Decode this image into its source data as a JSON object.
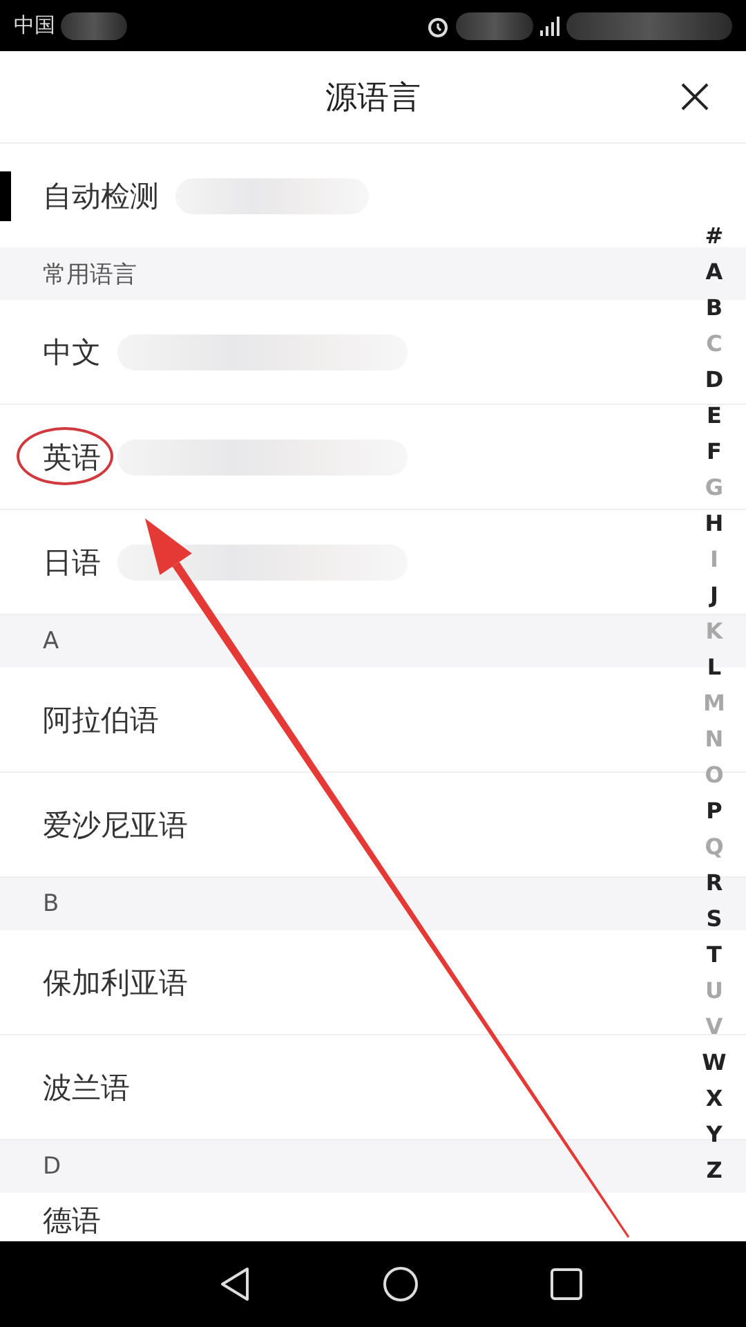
{
  "status_bar": {
    "carrier": "中国"
  },
  "header": {
    "title": "源语言"
  },
  "auto_detect": {
    "label": "自动检测",
    "selected": true,
    "redacted": true
  },
  "sections": [
    {
      "title": "常用语言",
      "items": [
        {
          "label": "中文",
          "redacted": true,
          "circled": false
        },
        {
          "label": "英语",
          "redacted": true,
          "circled": true
        },
        {
          "label": "日语",
          "redacted": true,
          "circled": false
        }
      ]
    },
    {
      "title": "A",
      "items": [
        {
          "label": "阿拉伯语",
          "redacted": false,
          "circled": false
        },
        {
          "label": "爱沙尼亚语",
          "redacted": false,
          "circled": false
        }
      ]
    },
    {
      "title": "B",
      "items": [
        {
          "label": "保加利亚语",
          "redacted": false,
          "circled": false
        },
        {
          "label": "波兰语",
          "redacted": false,
          "circled": false
        }
      ]
    },
    {
      "title": "D",
      "items": [
        {
          "label": "德语",
          "redacted": false,
          "circled": false
        }
      ]
    }
  ],
  "index": [
    {
      "letter": "#",
      "enabled": true
    },
    {
      "letter": "A",
      "enabled": true
    },
    {
      "letter": "B",
      "enabled": true
    },
    {
      "letter": "C",
      "enabled": false
    },
    {
      "letter": "D",
      "enabled": true
    },
    {
      "letter": "E",
      "enabled": true
    },
    {
      "letter": "F",
      "enabled": true
    },
    {
      "letter": "G",
      "enabled": false
    },
    {
      "letter": "H",
      "enabled": true
    },
    {
      "letter": "I",
      "enabled": false
    },
    {
      "letter": "J",
      "enabled": true
    },
    {
      "letter": "K",
      "enabled": false
    },
    {
      "letter": "L",
      "enabled": true
    },
    {
      "letter": "M",
      "enabled": false
    },
    {
      "letter": "N",
      "enabled": false
    },
    {
      "letter": "O",
      "enabled": false
    },
    {
      "letter": "P",
      "enabled": true
    },
    {
      "letter": "Q",
      "enabled": false
    },
    {
      "letter": "R",
      "enabled": true
    },
    {
      "letter": "S",
      "enabled": true
    },
    {
      "letter": "T",
      "enabled": true
    },
    {
      "letter": "U",
      "enabled": false
    },
    {
      "letter": "V",
      "enabled": false
    },
    {
      "letter": "W",
      "enabled": true
    },
    {
      "letter": "X",
      "enabled": true
    },
    {
      "letter": "Y",
      "enabled": true
    },
    {
      "letter": "Z",
      "enabled": true
    }
  ],
  "annotations": [
    {
      "kind": "arrow"
    }
  ]
}
